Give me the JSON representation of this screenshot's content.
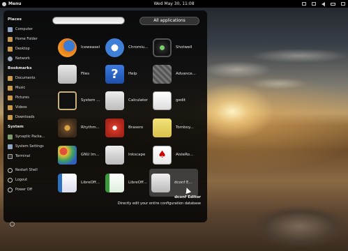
{
  "top_panel": {
    "menu_label": "Menu",
    "clock": "Wed May 30, 11:08"
  },
  "sidebar": {
    "places_title": "Places",
    "places": [
      {
        "label": "Computer",
        "icon": "computer-icon"
      },
      {
        "label": "Home Folder",
        "icon": "folder-icon"
      },
      {
        "label": "Desktop",
        "icon": "folder-icon"
      },
      {
        "label": "Network",
        "icon": "network-icon"
      }
    ],
    "bookmarks_title": "Bookmarks",
    "bookmarks": [
      {
        "label": "Documents",
        "icon": "folder-icon"
      },
      {
        "label": "Music",
        "icon": "folder-icon"
      },
      {
        "label": "Pictures",
        "icon": "folder-icon"
      },
      {
        "label": "Videos",
        "icon": "folder-icon"
      },
      {
        "label": "Downloads",
        "icon": "folder-icon"
      }
    ],
    "system_title": "System",
    "system": [
      {
        "label": "Synaptic Packa...",
        "icon": "package-icon"
      },
      {
        "label": "System Settings",
        "icon": "settings-icon"
      },
      {
        "label": "Terminal",
        "icon": "terminal-icon"
      }
    ],
    "session": [
      {
        "label": "Restart Shell",
        "icon": "restart-icon"
      },
      {
        "label": "Logout",
        "icon": "logout-icon"
      },
      {
        "label": "Power Off",
        "icon": "power-icon"
      }
    ]
  },
  "search": {
    "placeholder": "",
    "value": ""
  },
  "all_applications_label": "All applications",
  "apps": [
    {
      "label": "Iceweasel",
      "icon": "firefox-icon"
    },
    {
      "label": "Chromiu...",
      "icon": "chromium-icon"
    },
    {
      "label": "Shotwell",
      "icon": "shotwell-icon"
    },
    {
      "label": "Files",
      "icon": "files-icon"
    },
    {
      "label": "Help",
      "icon": "help-icon"
    },
    {
      "label": "Advance...",
      "icon": "advanced-settings-icon"
    },
    {
      "label": "System ...",
      "icon": "system-monitor-icon"
    },
    {
      "label": "Calculator",
      "icon": "calculator-icon"
    },
    {
      "label": "gedit",
      "icon": "gedit-icon"
    },
    {
      "label": "Rhythm...",
      "icon": "rhythmbox-icon"
    },
    {
      "label": "Brasero",
      "icon": "brasero-icon"
    },
    {
      "label": "Tomboy...",
      "icon": "tomboy-icon"
    },
    {
      "label": "GNU Im...",
      "icon": "gimp-icon"
    },
    {
      "label": "Inkscape",
      "icon": "inkscape-icon"
    },
    {
      "label": "AisleRo...",
      "icon": "aisleriot-icon"
    },
    {
      "label": "LibreOff...",
      "icon": "libreoffice-writer-icon"
    },
    {
      "label": "LibreOff...",
      "icon": "libreoffice-calc-icon"
    },
    {
      "label": "dconf E...",
      "icon": "dconf-editor-icon"
    }
  ],
  "selected_app": {
    "name": "dconf Editor",
    "description": "Directly edit your entire configuration database"
  }
}
